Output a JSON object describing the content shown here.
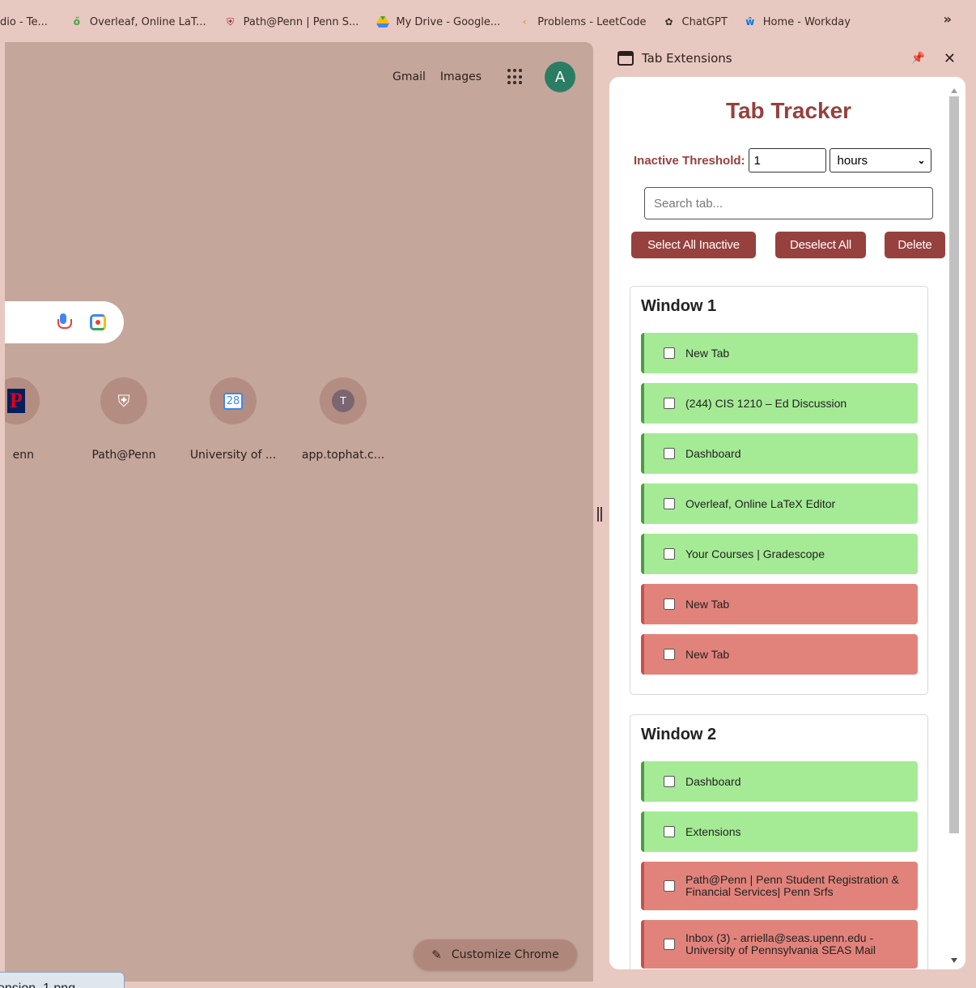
{
  "bookmarks": [
    {
      "icon": "studio-icon",
      "label": "dio - Te..."
    },
    {
      "icon": "overleaf-icon",
      "label": "Overleaf, Online LaT..."
    },
    {
      "icon": "penn-shield-icon",
      "label": "Path@Penn | Penn S..."
    },
    {
      "icon": "google-drive-icon",
      "label": "My Drive - Google..."
    },
    {
      "icon": "leetcode-icon",
      "label": "Problems - LeetCode"
    },
    {
      "icon": "chatgpt-icon",
      "label": "ChatGPT"
    },
    {
      "icon": "workday-icon",
      "label": "Home - Workday"
    }
  ],
  "bookmarks_more": "»",
  "ntp": {
    "gmail": "Gmail",
    "images": "Images",
    "avatar_letter": "A",
    "shortcuts": [
      {
        "label": "enn",
        "glyph": "P"
      },
      {
        "label": "Path@Penn",
        "glyph": "⛨"
      },
      {
        "label": "University of ...",
        "glyph": "28"
      },
      {
        "label": "app.tophat.c...",
        "glyph": "T"
      }
    ],
    "customize_label": "Customize Chrome"
  },
  "side_panel": {
    "header_title": "Tab Extensions",
    "app_title": "Tab Tracker",
    "threshold_label": "Inactive Threshold:",
    "threshold_value": "1",
    "threshold_unit": "hours",
    "search_placeholder": "Search tab...",
    "buttons": {
      "select_all_inactive": "Select All Inactive",
      "deselect_all": "Deselect All",
      "delete": "Delete"
    },
    "windows": [
      {
        "title": "Window 1",
        "tabs": [
          {
            "title": "New Tab",
            "status": "active"
          },
          {
            "title": "(244) CIS 1210 – Ed Discussion",
            "status": "active"
          },
          {
            "title": "Dashboard",
            "status": "active"
          },
          {
            "title": "Overleaf, Online LaTeX Editor",
            "status": "active"
          },
          {
            "title": "Your Courses | Gradescope",
            "status": "active"
          },
          {
            "title": "New Tab",
            "status": "inactive"
          },
          {
            "title": "New Tab",
            "status": "inactive"
          }
        ]
      },
      {
        "title": "Window 2",
        "tabs": [
          {
            "title": "Dashboard",
            "status": "active"
          },
          {
            "title": "Extensions",
            "status": "active"
          },
          {
            "title": "Path@Penn | Penn Student Registration & Financial Services| Penn Srfs",
            "status": "inactive"
          },
          {
            "title": "Inbox (3) - arriella@seas.upenn.edu - University of Pennsylvania SEAS Mail",
            "status": "inactive"
          }
        ]
      }
    ]
  },
  "download_tab": "ension_1.png",
  "colors": {
    "accent": "#96413e",
    "active_tab": "#a5eb95",
    "inactive_tab": "#e2837b",
    "ntp_background": "#c4a69b",
    "chrome_frame": "#e8c9c1"
  }
}
